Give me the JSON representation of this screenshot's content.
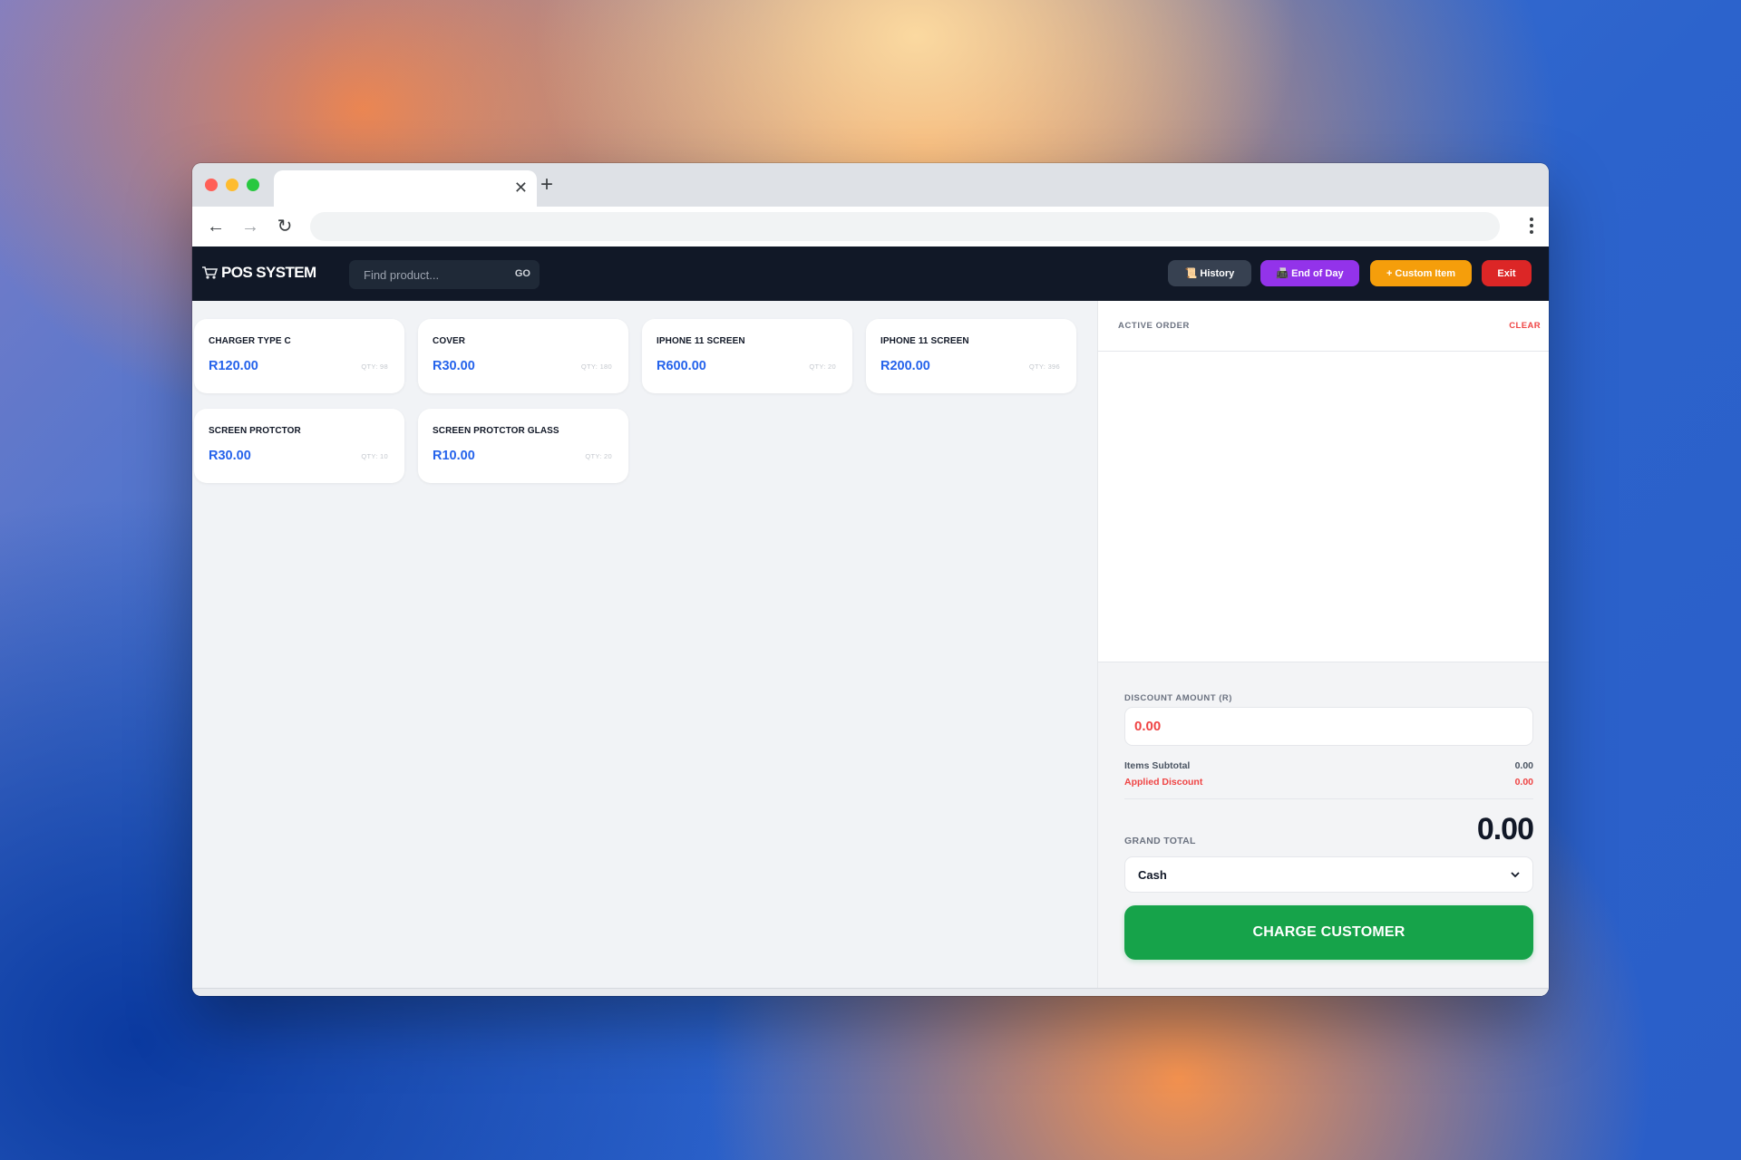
{
  "browser": {
    "tab_close": "✕",
    "new_tab": "+",
    "back": "←",
    "forward": "→",
    "reload": "↻"
  },
  "app": {
    "logo_text": "POS SYSTEM",
    "search": {
      "placeholder": "Find product...",
      "button_label": "GO"
    },
    "buttons": {
      "history": {
        "icon": "📜",
        "label": "History"
      },
      "end_of_day": {
        "icon": "📠",
        "label": "End of Day"
      },
      "custom_item": {
        "label": "+ Custom Item"
      },
      "exit": {
        "label": "Exit"
      }
    }
  },
  "products": [
    {
      "name": "CHARGER TYPE C",
      "price": "R120.00",
      "qty": "QTY: 98"
    },
    {
      "name": "COVER",
      "price": "R30.00",
      "qty": "QTY: 180"
    },
    {
      "name": "IPHONE 11 SCREEN",
      "price": "R600.00",
      "qty": "QTY: 20"
    },
    {
      "name": "IPHONE 11 SCREEN",
      "price": "R200.00",
      "qty": "QTY: 396"
    },
    {
      "name": "SCREEN PROTCTOR",
      "price": "R30.00",
      "qty": "QTY: 10"
    },
    {
      "name": "SCREEN PROTCTOR GLASS",
      "price": "R10.00",
      "qty": "QTY: 20"
    }
  ],
  "order": {
    "title": "ACTIVE ORDER",
    "clear_label": "CLEAR",
    "discount_label": "DISCOUNT AMOUNT (R)",
    "discount_value": "0.00",
    "subtotal_label": "Items Subtotal",
    "subtotal_value": "0.00",
    "applied_discount_label": "Applied Discount",
    "applied_discount_value": "0.00",
    "grand_total_label": "GRAND TOTAL",
    "grand_total_value": "0.00",
    "payment_method": "Cash",
    "charge_label": "CHARGE CUSTOMER"
  },
  "colors": {
    "accent_blue": "#2563eb",
    "success_green": "#16a34a",
    "danger_red": "#dc2626",
    "purple": "#9333ea",
    "amber": "#f59e0b",
    "dark_header": "#111827"
  }
}
